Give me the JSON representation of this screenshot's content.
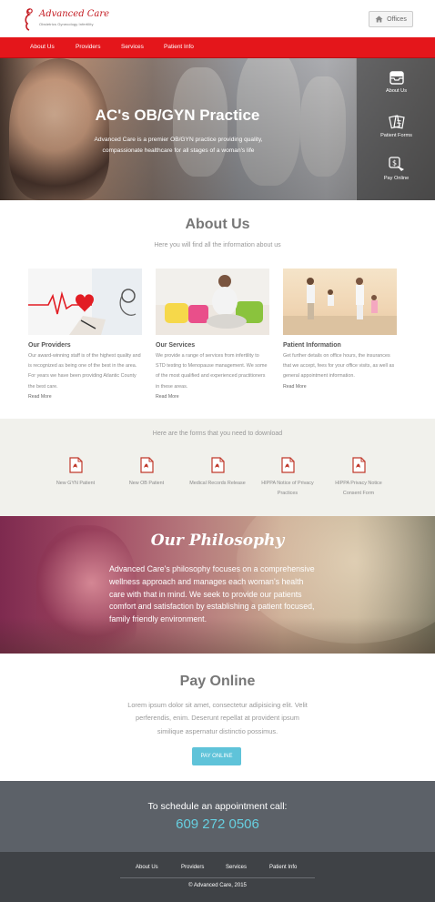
{
  "header": {
    "brand": "Advanced Care",
    "tagline": "Obstetrics Gynecology Infertility",
    "offices_label": "Offices",
    "offices_icon": "home-icon"
  },
  "nav": {
    "items": [
      {
        "label": "About Us"
      },
      {
        "label": "Providers"
      },
      {
        "label": "Services"
      },
      {
        "label": "Patient Info"
      }
    ]
  },
  "hero": {
    "title": "AC's OB/GYN Practice",
    "text": "Advanced Care is a premier OB/GYN practice providing quality, compassionate healthcare for all stages of a woman's life",
    "side_items": [
      {
        "label": "About Us",
        "icon": "inbox-icon"
      },
      {
        "label": "Patient Forms",
        "icon": "forms-icon"
      },
      {
        "label": "Pay Online",
        "icon": "pay-icon"
      }
    ]
  },
  "about": {
    "title": "About Us",
    "subtitle": "Here you will find all the information about us",
    "cards": [
      {
        "title": "Our Providers",
        "text": "Our award-winning staff is of the highest quality and is recognized as being one of the best in the area. For years we have been providing Atlantic County the best care.",
        "more": "Read More"
      },
      {
        "title": "Our Services",
        "text": "We provide a range of services from infertility to STD testing to Menopause management. We some of the most qualified and experienced practitioners in these areas.",
        "more": "Read More"
      },
      {
        "title": "Patient Information",
        "text": "Get further details on office hours, the insurances that we accept, fees for your office visits, as well as general appointment information.",
        "more": "Read More"
      }
    ]
  },
  "forms": {
    "heading": "Here are the forms that you need to download",
    "items": [
      {
        "label": "New GYN Patient"
      },
      {
        "label": "New OB Patient"
      },
      {
        "label": "Medical Records Release"
      },
      {
        "label": "HIPPA Notice of Privacy Practices"
      },
      {
        "label": "HIPPA Privacy Notice Consent Form"
      }
    ]
  },
  "philosophy": {
    "title": "Our Philosophy",
    "text": "Advanced Care's philosophy focuses on a comprehensive wellness approach and manages each woman's health care with that in mind. We seek to provide our patients comfort and satisfaction by establishing a patient focused, family friendly environment."
  },
  "pay": {
    "title": "Pay Online",
    "text": "Lorem ipsum dolor sit amet, consectetur adipisicing elit. Velit perferendis, enim. Deserunt repellat at provident ipsum similique aspernatur distinctio possimus.",
    "button": "PAY ONLINE"
  },
  "appointment": {
    "line": "To schedule an appointment call:",
    "phone": "609 272 0506"
  },
  "footer": {
    "links": [
      {
        "label": "About Us"
      },
      {
        "label": "Providers"
      },
      {
        "label": "Services"
      },
      {
        "label": "Patient Info"
      }
    ],
    "copyright": "© Advanced Care, 2015"
  },
  "colors": {
    "brand_red": "#e4161b",
    "accent_cyan": "#5fc3d9",
    "phone_cyan": "#66cfe0",
    "appointment_bg": "#5c6168",
    "footer_bg": "#3f4246"
  }
}
